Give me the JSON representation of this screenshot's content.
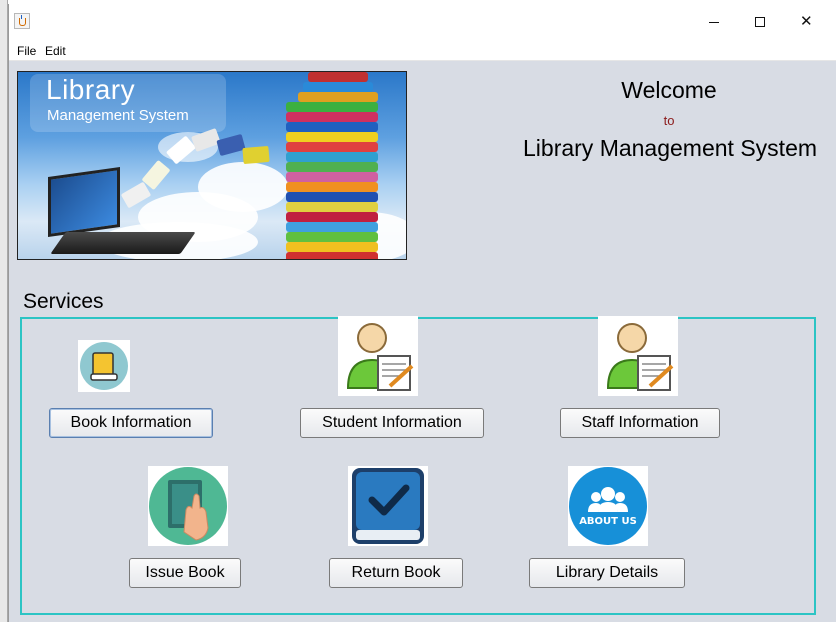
{
  "menu": {
    "file": "File",
    "edit": "Edit"
  },
  "banner": {
    "title": "Library",
    "subtitle": "Management System"
  },
  "welcome": {
    "line1": "Welcome",
    "line2": "to",
    "line3": "Library Management System"
  },
  "services": {
    "heading": "Services",
    "buttons": [
      {
        "label": "Book Information",
        "icon": "book-icon"
      },
      {
        "label": "Student Information",
        "icon": "student-icon"
      },
      {
        "label": "Staff Information",
        "icon": "staff-icon"
      },
      {
        "label": "Issue Book",
        "icon": "issue-book-icon"
      },
      {
        "label": "Return Book",
        "icon": "return-book-icon"
      },
      {
        "label": "Library Details",
        "icon": "about-us-icon"
      }
    ],
    "about_badge": "ABOUT US"
  },
  "colors": {
    "panel_border": "#2cc4c4",
    "content_bg": "#d8dce4",
    "to_text": "#8b1a1a"
  }
}
